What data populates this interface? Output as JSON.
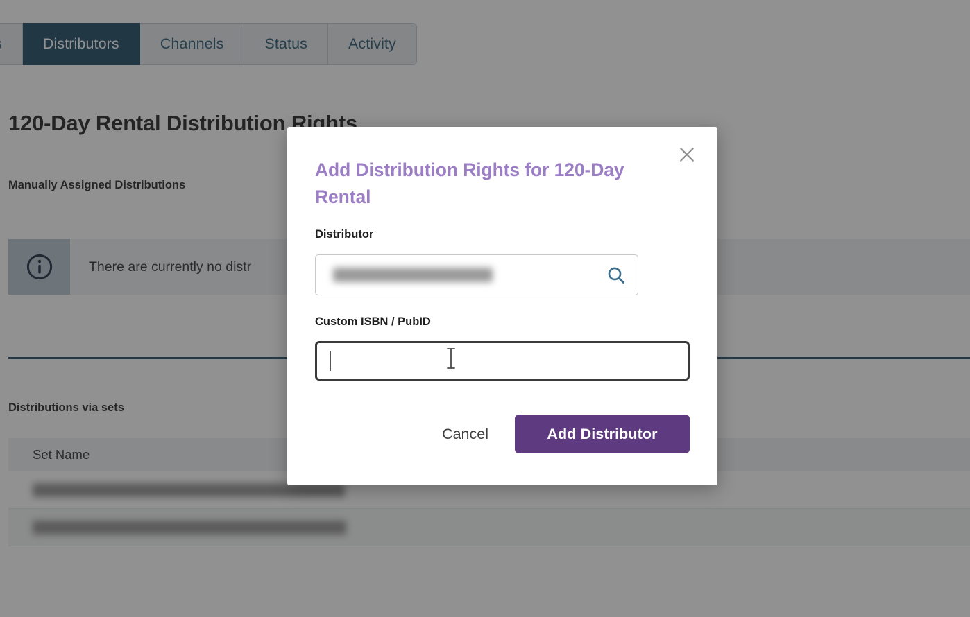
{
  "tabs": [
    {
      "label": "s",
      "active": false,
      "partial": true
    },
    {
      "label": "Distributors",
      "active": true
    },
    {
      "label": "Channels",
      "active": false
    },
    {
      "label": "Status",
      "active": false
    },
    {
      "label": "Activity",
      "active": false
    }
  ],
  "page": {
    "title": "120-Day Rental Distribution Rights",
    "manual_section_label": "Manually Assigned Distributions",
    "info_banner": {
      "icon": "info-circle-icon",
      "text": "There are currently no distr",
      "icon_box_color": "#b6c4cf"
    },
    "sets_section_label": "Distributions via sets",
    "sets_table": {
      "columns": [
        "Set Name"
      ],
      "rows": [
        {
          "set_name": ""
        },
        {
          "set_name": ""
        }
      ]
    }
  },
  "modal": {
    "title": "Add Distribution Rights for 120-Day Rental",
    "close_icon": "close-icon",
    "distributor": {
      "label": "Distributor",
      "value": "",
      "placeholder": "",
      "search_icon": "search-icon"
    },
    "isbn": {
      "label": "Custom ISBN / PubID",
      "value": "",
      "placeholder": ""
    },
    "cancel_label": "Cancel",
    "submit_label": "Add Distributor"
  },
  "colors": {
    "active_tab": "#16445f",
    "tab_text": "#22536f",
    "modal_title_purple": "#9b7ec4",
    "primary_button_purple": "#5e3b80",
    "search_icon_blue": "#3d6e8c",
    "divider_blue": "#1f4a63"
  }
}
